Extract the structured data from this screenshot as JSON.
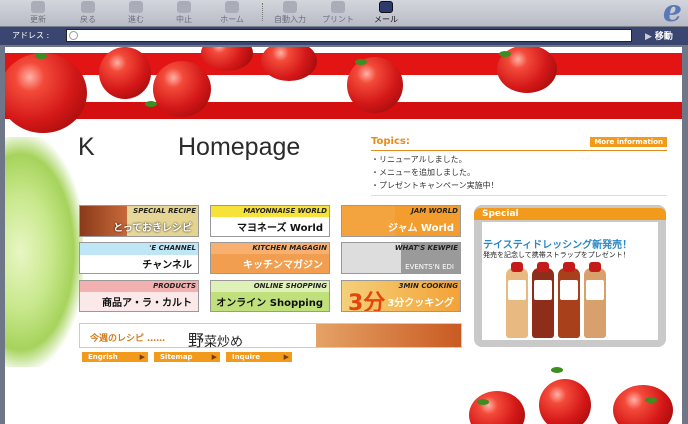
{
  "toolbar": {
    "buttons": [
      {
        "label": "更新"
      },
      {
        "label": "戻る"
      },
      {
        "label": "進む"
      },
      {
        "label": "中止"
      },
      {
        "label": "ホーム"
      },
      {
        "label": "自動入力"
      },
      {
        "label": "プリント"
      },
      {
        "label": "メール"
      }
    ]
  },
  "address_bar": {
    "label": "アドレス :",
    "value": "",
    "go_label": "移動"
  },
  "page": {
    "title_left": "K",
    "title_right": "Homepage",
    "topics": {
      "title": "Topics:",
      "more_label": "More information",
      "items": [
        "・リニューアルしました。",
        "・メニューを追加しました。",
        "・プレゼントキャンペーン実施中！"
      ]
    },
    "menu": [
      {
        "sub": "SPECIAL RECIPE",
        "main": "とっておきレシピ"
      },
      {
        "sub": "MAYONNAISE WORLD",
        "main": "マヨネーズ World"
      },
      {
        "sub": "JAM WORLD",
        "main": "ジャム World"
      },
      {
        "sub": "'E CHANNEL",
        "main": "チャンネル"
      },
      {
        "sub": "KITCHEN MAGAGIN",
        "main": "キッチンマガジン"
      },
      {
        "sub": "WHAT'S KEWPIE",
        "main": "EVENTS'N EDI"
      },
      {
        "sub": "PRODUCTS",
        "main": "商品ア・ラ・カルト"
      },
      {
        "sub": "ONLINE SHOPPING",
        "main": "オンライン Shopping"
      },
      {
        "sub": "3MIN COOKING",
        "main": "3分クッキング",
        "big": "3分"
      }
    ],
    "recipe": {
      "label": "今週のレシピ ……",
      "name_kanji": "野",
      "name_rest": "菜炒め"
    },
    "bottom_links": [
      "Engrish",
      "Sitemap",
      "Inquire"
    ],
    "special": {
      "header": "Special",
      "title": "テイスティドレッシング新発売！",
      "subtitle": "発売を記念して携帯ストラップをプレゼント！"
    }
  },
  "colors": {
    "accent_orange": "#f29a1c",
    "tomato_red": "#e21414",
    "address_bar_bg": "#3a4670"
  }
}
